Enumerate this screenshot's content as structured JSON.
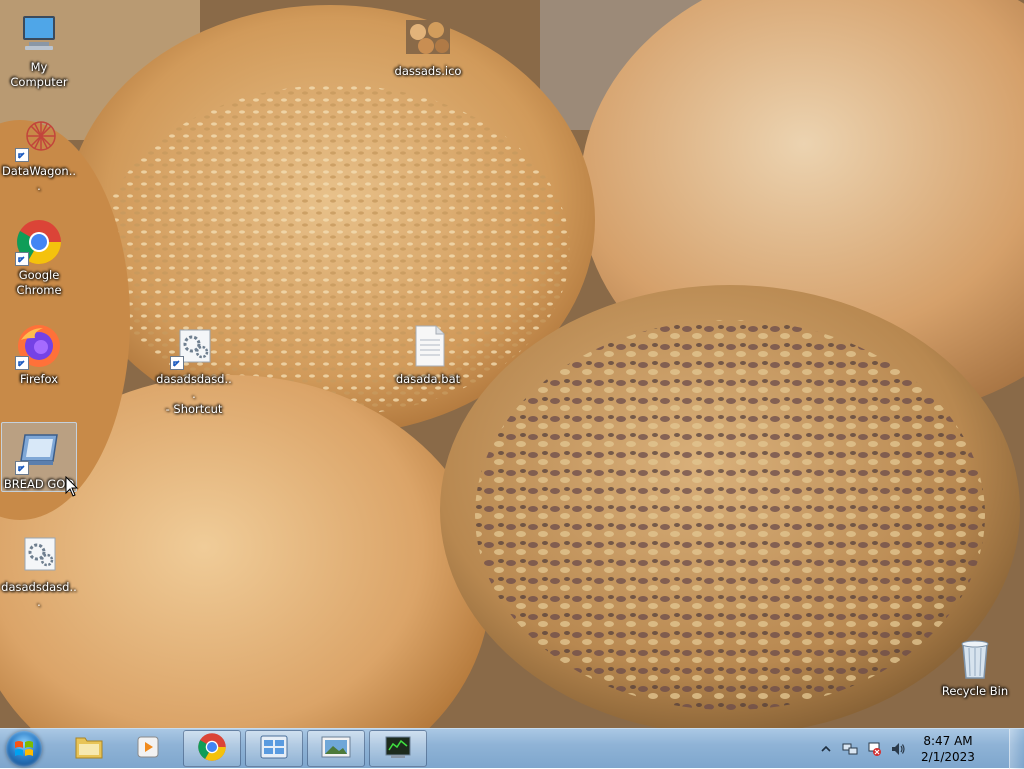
{
  "desktop": {
    "icons": [
      {
        "label": "My Computer",
        "icon": "computer-icon"
      },
      {
        "label": "DataWagon...",
        "icon": "datawagon-logo-icon"
      },
      {
        "label": "Google\nChrome",
        "icon": "chrome-icon"
      },
      {
        "label": "Firefox",
        "icon": "firefox-icon"
      },
      {
        "label": "BREAD GOD",
        "icon": "bread-god-app-icon"
      },
      {
        "label": "dasadsdasd...",
        "icon": "settings-file-icon"
      },
      {
        "label": "dassads.ico",
        "icon": "bread-image-icon"
      },
      {
        "label": "dasadsdasd...\n- Shortcut",
        "icon": "settings-file-icon"
      },
      {
        "label": "dasada.bat",
        "icon": "batch-file-icon"
      },
      {
        "label": "Recycle Bin",
        "icon": "recycle-bin-icon"
      }
    ],
    "selected_icon": "BREAD GOD"
  },
  "taskbar": {
    "pinned": [
      {
        "name": "windows-explorer",
        "icon": "folder-icon"
      },
      {
        "name": "media-player",
        "icon": "media-player-icon"
      },
      {
        "name": "google-chrome",
        "icon": "chrome-icon"
      },
      {
        "name": "control-panel",
        "icon": "control-panel-icon"
      },
      {
        "name": "photo-viewer",
        "icon": "photo-viewer-icon"
      },
      {
        "name": "task-manager",
        "icon": "terminal-icon"
      }
    ],
    "tray": {
      "icons": [
        "show-hidden-icons-icon",
        "network-icon",
        "action-center-icon",
        "volume-icon"
      ],
      "time": "8:47 AM",
      "date": "2/1/2023"
    }
  },
  "colors": {
    "taskbar": "#8fb3d6",
    "selection": "#a0c8f0"
  }
}
